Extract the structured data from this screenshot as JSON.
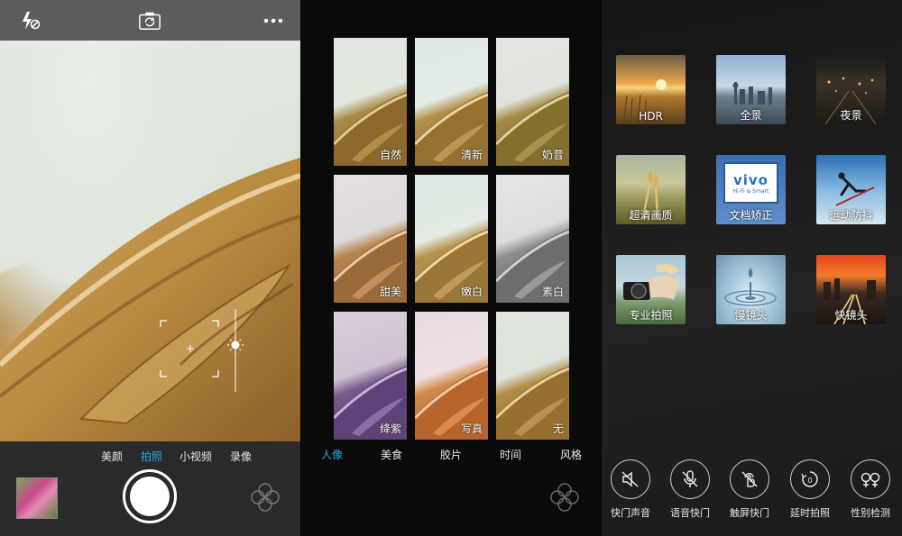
{
  "camera": {
    "modes": [
      "美颜",
      "拍照",
      "小视频",
      "录像"
    ],
    "active_mode": "拍照"
  },
  "filters": {
    "items": [
      "自然",
      "清新",
      "奶昔",
      "甜美",
      "嫩白",
      "素白",
      "绛紫",
      "写真",
      "无"
    ],
    "categories": [
      "人像",
      "美食",
      "胶片",
      "时间",
      "风格"
    ],
    "active_category": "人像"
  },
  "modes": {
    "items": [
      "HDR",
      "全景",
      "夜景",
      "超清画质",
      "文档矫正",
      "运动防抖",
      "专业拍照",
      "慢镜头",
      "快镜头"
    ],
    "doc_logo_text": "vivo",
    "doc_logo_sub": "Hi-Fi & Smart"
  },
  "toggles": {
    "items": [
      "快门声音",
      "语音快门",
      "触屏快门",
      "延时拍照",
      "性别检测"
    ]
  },
  "colors": {
    "accent": "#27a9e6",
    "topbar": "#5c5c5c"
  }
}
